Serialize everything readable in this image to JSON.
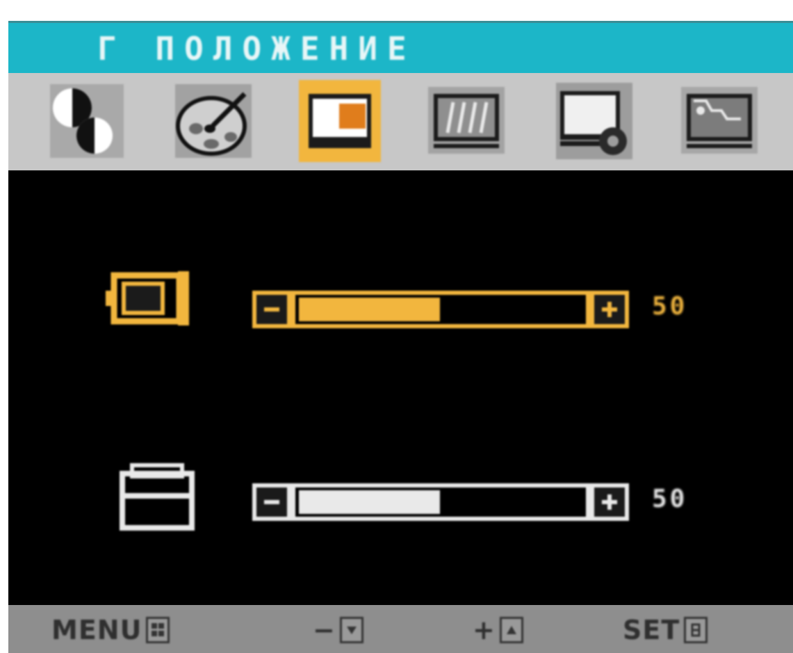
{
  "menu": {
    "title": "Г ПОЛОЖЕНИЕ",
    "tabs": [
      {
        "icon": "brightness-contrast-icon",
        "selected": false
      },
      {
        "icon": "color-palette-icon",
        "selected": false
      },
      {
        "icon": "position-icon",
        "selected": true
      },
      {
        "icon": "tracking-icon",
        "selected": false
      },
      {
        "icon": "setup-icon",
        "selected": false
      },
      {
        "icon": "flatron-function-icon",
        "selected": false
      }
    ]
  },
  "controls": [
    {
      "name": "horizontal-position",
      "icon": "horizontal-position-icon",
      "value": "50",
      "level": 0.5,
      "active": true
    },
    {
      "name": "vertical-position",
      "icon": "vertical-position-icon",
      "value": "50",
      "level": 0.5,
      "active": false
    }
  ],
  "footer": {
    "menu_label": "MENU",
    "minus_label": "−",
    "plus_label": "+",
    "set_label": "SET"
  },
  "colors": {
    "title_bar": "#1cb6c8",
    "icon_bar": "#c7c7c7",
    "highlight": "#f2b63e",
    "inactive": "#e9e9e9",
    "footer": "#8e8e8e"
  }
}
